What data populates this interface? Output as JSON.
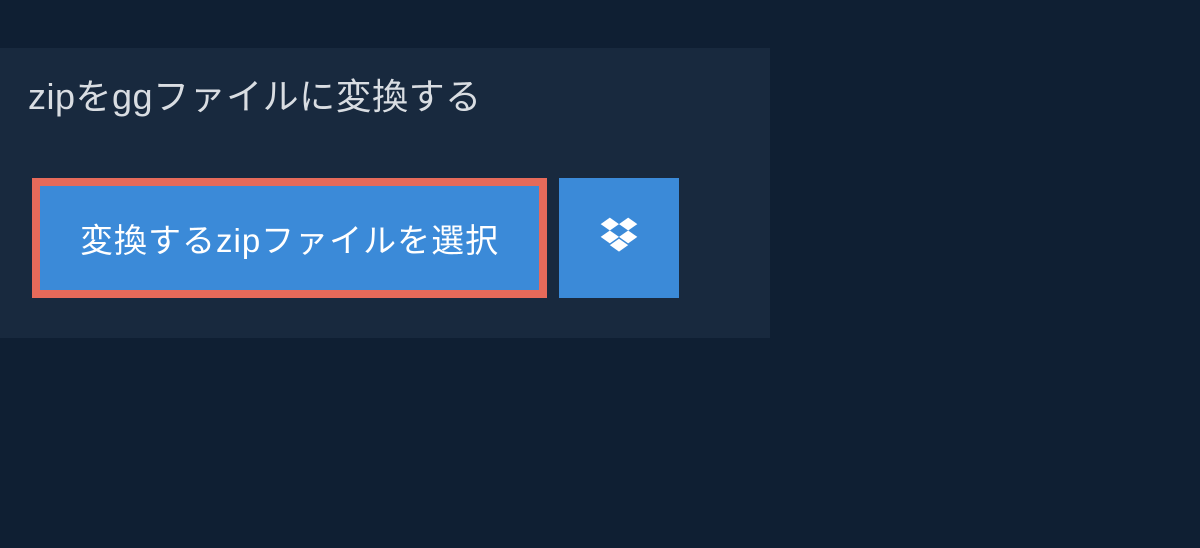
{
  "header": {
    "title": "zipをggファイルに変換する"
  },
  "actions": {
    "select_file_label": "変換するzipファイルを選択",
    "dropbox_icon": "dropbox-icon"
  }
}
